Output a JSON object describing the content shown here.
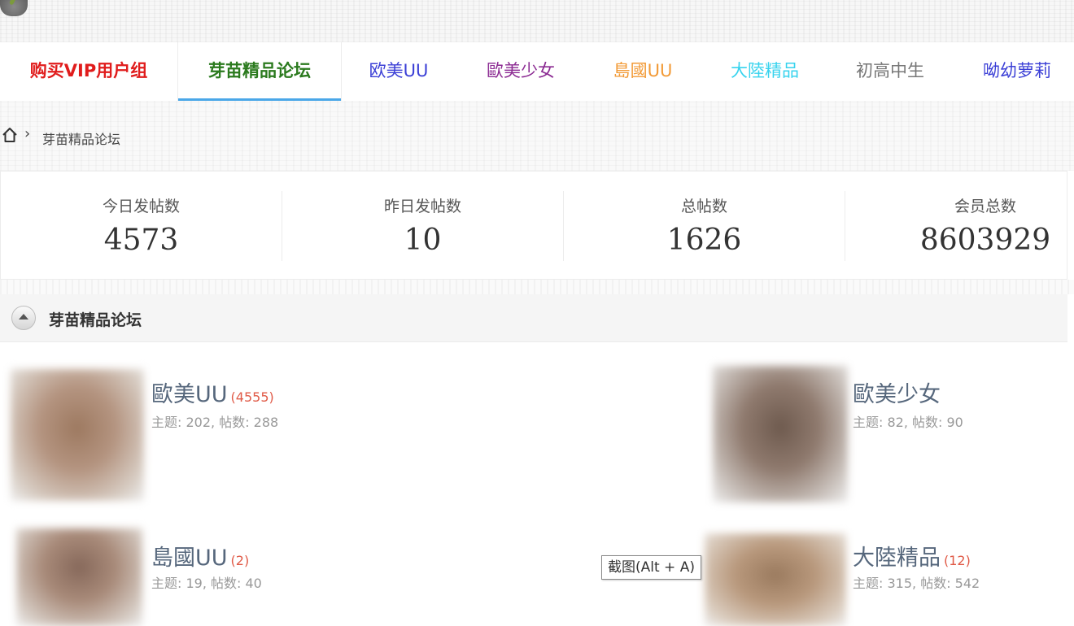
{
  "nav": {
    "items": [
      {
        "label": "购买VIP用户组",
        "color": "#e01c1c"
      },
      {
        "label": "芽苗精品论坛",
        "color": "#2b7a1e"
      },
      {
        "label": "欧美UU",
        "color": "#3b3fd6"
      },
      {
        "label": "歐美少女",
        "color": "#8b2a92"
      },
      {
        "label": "島國UU",
        "color": "#f29a36"
      },
      {
        "label": "大陸精品",
        "color": "#37d3ee"
      },
      {
        "label": "初高中生",
        "color": "#777777"
      },
      {
        "label": "呦幼萝莉",
        "color": "#3b3fd6"
      }
    ],
    "active_accent": "#4aa7e8"
  },
  "breadcrumb": {
    "home_icon": "home-icon",
    "separator": "›",
    "current": "芽苗精品论坛"
  },
  "stats": [
    {
      "label": "今日发帖数",
      "value": "4573"
    },
    {
      "label": "昨日发帖数",
      "value": "10"
    },
    {
      "label": "总帖数",
      "value": "1626"
    },
    {
      "label": "会员总数",
      "value": "8603929"
    }
  ],
  "section": {
    "title": "芽苗精品论坛",
    "collapse_icon": "collapse-up-icon"
  },
  "forums": [
    {
      "name": "歐美UU",
      "today": "(4555)",
      "meta": "主题: 202, 帖数: 288"
    },
    {
      "name": "歐美少女",
      "today": "",
      "meta": "主题: 82, 帖数: 90"
    },
    {
      "name": "島國UU",
      "today": "(2)",
      "meta": "主题: 19, 帖数: 40"
    },
    {
      "name": "大陸精品",
      "today": "(12)",
      "meta": "主题: 315, 帖数: 542"
    }
  ],
  "tooltip": "截图(Alt + A)"
}
